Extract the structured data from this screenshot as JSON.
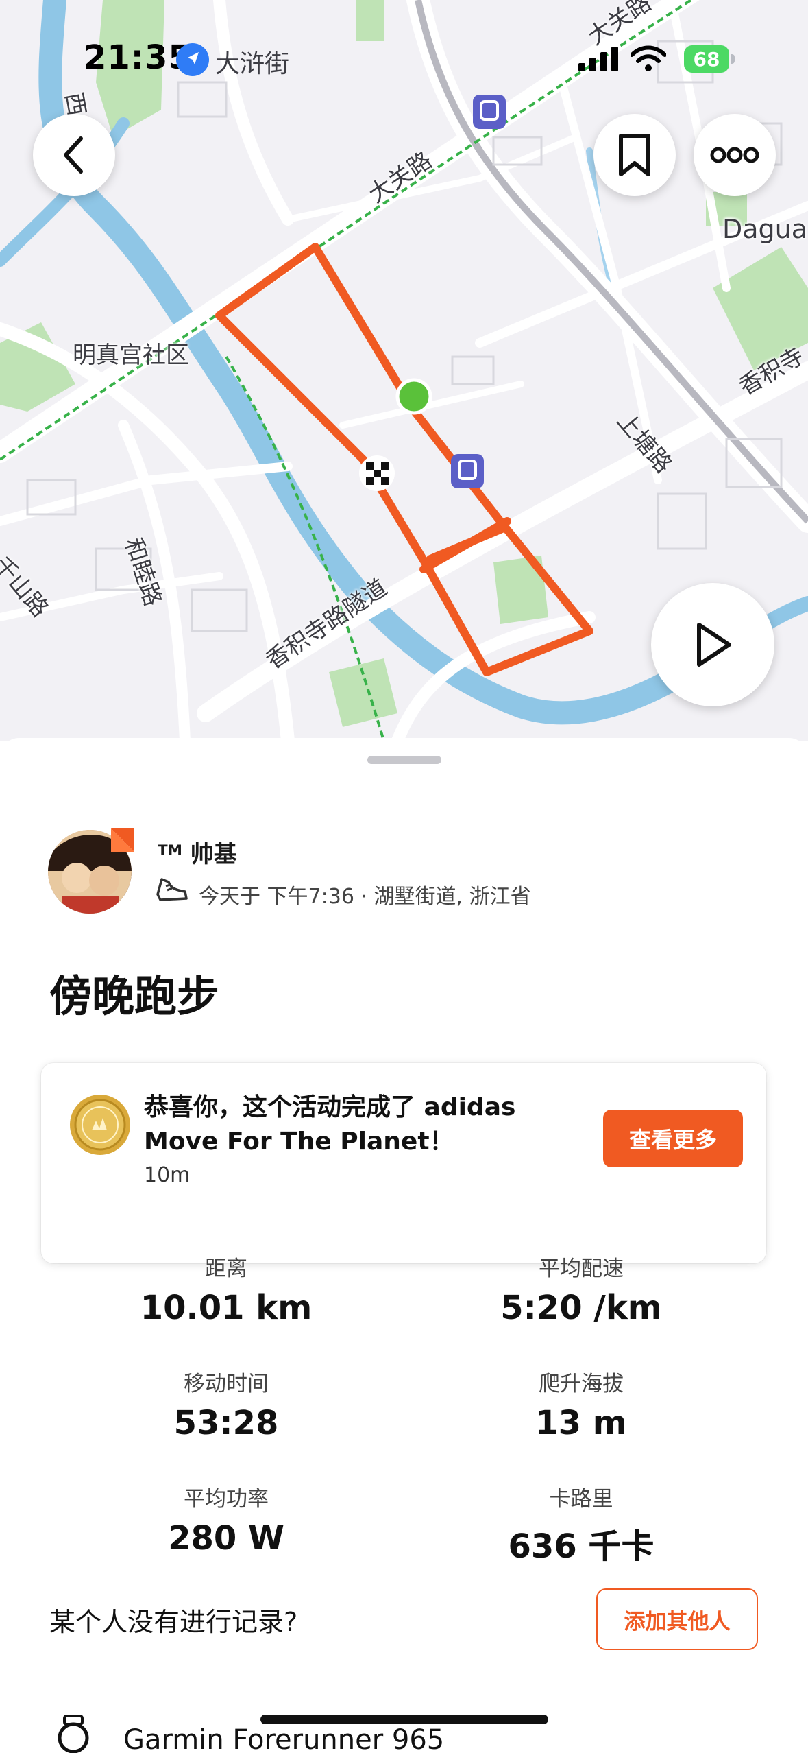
{
  "status_bar": {
    "time": "21:35",
    "location_label": "大浒街",
    "battery_level": "68"
  },
  "map": {
    "labels": {
      "daguan_road_top": "大关路",
      "daguan_road_mid": "大关路",
      "mingzhen_gong": "明真宫社区",
      "shangtang_road": "上塘路",
      "xiangjisi_tunnel": "香积寺路隧道",
      "xiangjisi_road_right": "香积寺",
      "hemu_road": "和睦路",
      "daguan_en": "Dagua",
      "left_road_top": "西水路",
      "left_road_mid": "千山路"
    },
    "route_color": "#f05a22",
    "start_color": "#5ac13a"
  },
  "buttons": {
    "back": "back",
    "bookmark": "bookmark",
    "more": "more",
    "play": "play"
  },
  "athlete": {
    "name": "ᵀᴹ 帅基",
    "meta": "今天于 下午7:36 · 湖墅街道, 浙江省"
  },
  "activity": {
    "title": "傍晚跑步"
  },
  "achievement": {
    "text": "恭喜你，这个活动完成了 adidas Move For The Planet！",
    "time": "10m",
    "button_label": "查看更多"
  },
  "stats": [
    {
      "label": "距离",
      "value": "10.01 km"
    },
    {
      "label": "平均配速",
      "value": "5:20 /km"
    },
    {
      "label": "移动时间",
      "value": "53:28"
    },
    {
      "label": "爬升海拔",
      "value": "13 m"
    },
    {
      "label": "平均功率",
      "value": "280 W"
    },
    {
      "label": "卡路里",
      "value": "636 千卡"
    }
  ],
  "record_prompt": {
    "question": "某个人没有进行记录?",
    "button_label": "添加其他人"
  },
  "device": {
    "name": "Garmin Forerunner 965"
  },
  "colors": {
    "accent": "#f05a22",
    "map_water": "#8fc6e6",
    "map_park": "#bfe3b5"
  }
}
